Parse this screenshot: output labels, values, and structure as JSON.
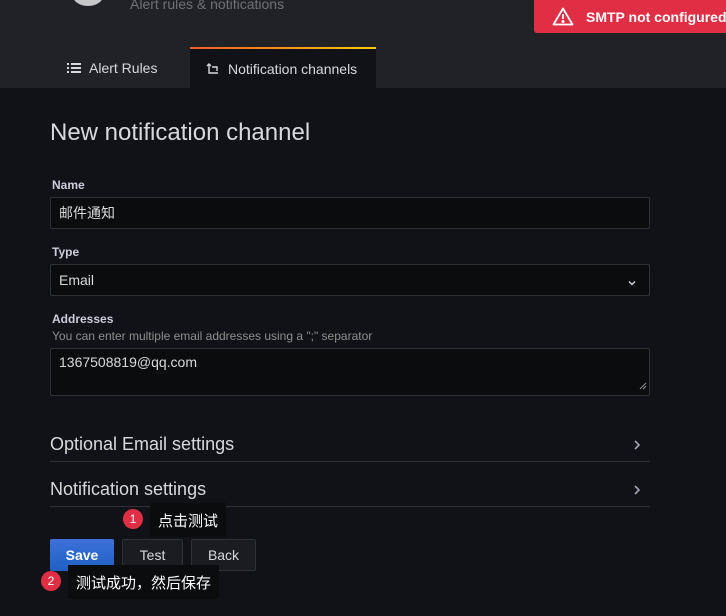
{
  "header": {
    "subtitle": "Alert rules & notifications",
    "tabs": [
      {
        "label": "Alert Rules",
        "icon": "list-icon",
        "active": false
      },
      {
        "label": "Notification channels",
        "icon": "bell-icon",
        "active": true
      }
    ]
  },
  "alert": {
    "text": "SMTP not configured,",
    "icon": "warning-icon",
    "color": "#e02f44"
  },
  "form": {
    "title": "New notification channel",
    "name": {
      "label": "Name",
      "value": "邮件通知"
    },
    "type": {
      "label": "Type",
      "value": "Email"
    },
    "addresses": {
      "label": "Addresses",
      "hint": "You can enter multiple email addresses using a \";\" separator",
      "value": "1367508819@qq.com"
    },
    "sections": [
      {
        "title": "Optional Email settings"
      },
      {
        "title": "Notification settings"
      }
    ],
    "buttons": {
      "save": "Save",
      "test": "Test",
      "back": "Back"
    }
  },
  "annotations": [
    {
      "number": "1",
      "text": "点击测试"
    },
    {
      "number": "2",
      "text": "测试成功，然后保存"
    }
  ],
  "colors": {
    "background": "#111217",
    "primary": "#1f60c4",
    "accent_gradient": [
      "#f05a28",
      "#fbca0a"
    ]
  }
}
